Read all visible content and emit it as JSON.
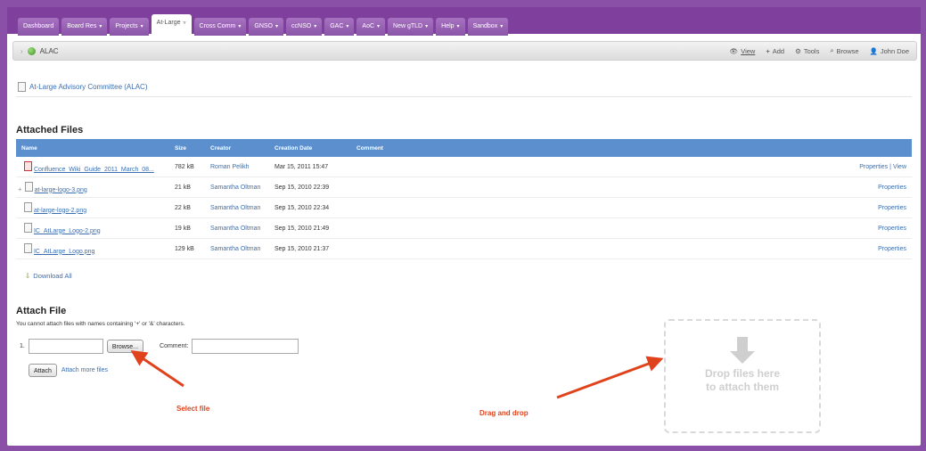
{
  "nav": {
    "tabs": [
      {
        "label": "Dashboard",
        "caret": ""
      },
      {
        "label": "Board Res",
        "caret": "▾"
      },
      {
        "label": "Projects",
        "caret": "▾"
      },
      {
        "label": "At-Large",
        "caret": "▿"
      },
      {
        "label": "Cross Comm",
        "caret": "▾"
      },
      {
        "label": "GNSO",
        "caret": "▾"
      },
      {
        "label": "ccNSO",
        "caret": "▾"
      },
      {
        "label": "GAC",
        "caret": "▾"
      },
      {
        "label": "AoC",
        "caret": "▾"
      },
      {
        "label": "New gTLD",
        "caret": "▾"
      },
      {
        "label": "Help",
        "caret": "▾"
      },
      {
        "label": "Sandbox",
        "caret": "▾"
      }
    ]
  },
  "breadcrumb": {
    "prefix": "›",
    "space": "ALAC",
    "actions": {
      "view": "View",
      "add": "Add",
      "tools": "Tools",
      "browse": "Browse",
      "user": "John Doe"
    }
  },
  "page": {
    "title": "At-Large Advisory Committee (ALAC)"
  },
  "attachments": {
    "title": "Attached Files",
    "columns": {
      "name": "Name",
      "size": "Size",
      "creator": "Creator",
      "date": "Creation Date",
      "comment": "Comment"
    },
    "rows": [
      {
        "expander": "",
        "name": "Confluence_Wiki_Guide_2011_March_08...",
        "size": "782 kB",
        "creator": "Roman Pelikh",
        "date": "Mar 15, 2011 15:47",
        "comment": "",
        "properties": "Properties",
        "view": "View",
        "pdf": true
      },
      {
        "expander": "+",
        "name": "at-large-logo-3.png",
        "size": "21 kB",
        "creator": "Samantha Oltman",
        "date": "Sep 15, 2010 22:39",
        "comment": "",
        "properties": "Properties",
        "view": "",
        "pdf": false
      },
      {
        "expander": "",
        "name": "at-large-logo-2.png",
        "size": "22 kB",
        "creator": "Samantha Oltman",
        "date": "Sep 15, 2010 22:34",
        "comment": "",
        "properties": "Properties",
        "view": "",
        "pdf": false
      },
      {
        "expander": "",
        "name": "IC_AtLarge_Logo-2.png",
        "size": "19 kB",
        "creator": "Samantha Oltman",
        "date": "Sep 15, 2010 21:49",
        "comment": "",
        "properties": "Properties",
        "view": "",
        "pdf": false
      },
      {
        "expander": "",
        "name": "IC_AtLarge_Logo.png",
        "size": "129 kB",
        "creator": "Samantha Oltman",
        "date": "Sep 15, 2010 21:37",
        "comment": "",
        "properties": "Properties",
        "view": "",
        "pdf": false
      }
    ],
    "download_all": "Download All"
  },
  "attach_form": {
    "title": "Attach File",
    "note": "You cannot attach files with names containing '+' or '&' characters.",
    "row_number": "1.",
    "browse_label": "Browse...",
    "comment_label": "Comment:",
    "attach_label": "Attach",
    "more_label": "Attach more files"
  },
  "dropzone": {
    "line1": "Drop files here",
    "line2": "to attach them"
  },
  "annotations": {
    "select_file": "Select file",
    "drag_drop": "Drag and drop"
  },
  "colors": {
    "frame": "#8a4fa6",
    "table_header": "#5c8fce",
    "link": "#3b6fb0",
    "annotation": "#e0421b"
  }
}
